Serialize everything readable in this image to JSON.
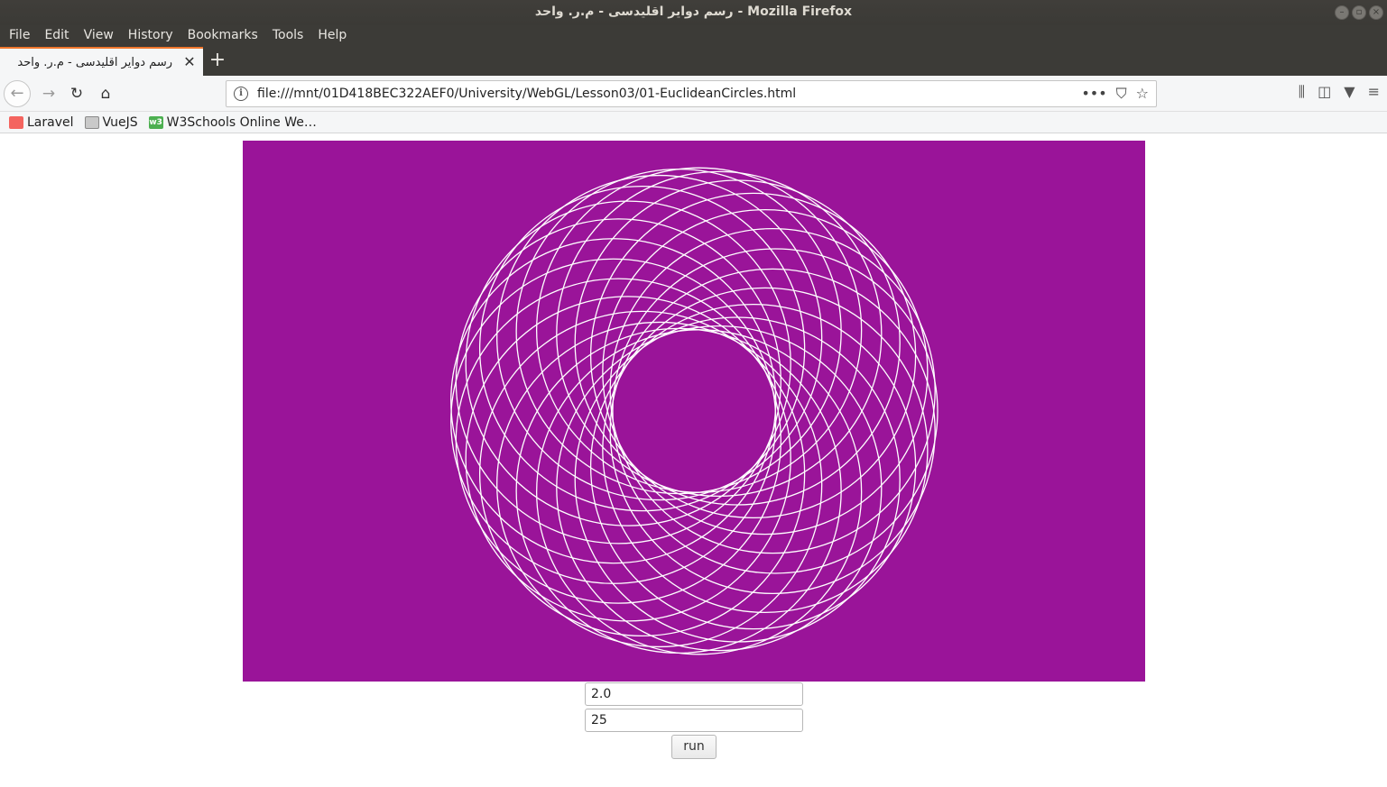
{
  "window": {
    "title": "رسم دوایر اقلیدسی - م.ر. واحد - Mozilla Firefox",
    "controls": [
      "minimize",
      "maximize",
      "close"
    ]
  },
  "menu": [
    "File",
    "Edit",
    "View",
    "History",
    "Bookmarks",
    "Tools",
    "Help"
  ],
  "tab": {
    "title": "رسم دوایر اقلیدسی - م.ر. واحد",
    "close": "✕",
    "new_tab": "+"
  },
  "navigation": {
    "url": "file:///mnt/01D418BEC322AEF0/University/WebGL/Lesson03/01-EuclideanCircles.html",
    "icons": [
      "back-icon",
      "forward-icon",
      "reload-icon",
      "home-icon",
      "info-icon",
      "page-actions-icon",
      "pocket-icon",
      "bookmark-star-icon",
      "library-icon",
      "sidebar-icon",
      "extension-icon",
      "menu-icon"
    ]
  },
  "bookmarks": [
    {
      "label": "Laravel",
      "icon": "laravel-icon",
      "color": "#f4645f"
    },
    {
      "label": "VueJS",
      "icon": "folder-icon",
      "color": "#8a8a8a"
    },
    {
      "label": "W3Schools Online We…",
      "icon": "w3schools-icon",
      "color": "#4caf50"
    }
  ],
  "page": {
    "canvas_background": "#9a1499",
    "stroke_color": "#ffffff",
    "circle_count": 25,
    "radius_value": "2.0",
    "count_value": "25",
    "run_label": "run"
  }
}
